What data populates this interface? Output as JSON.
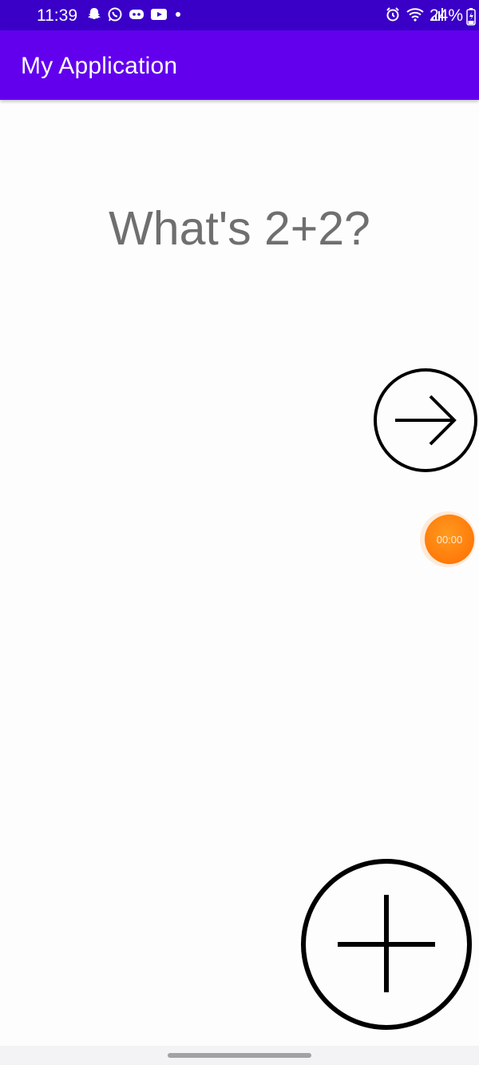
{
  "status_bar": {
    "time": "11:39",
    "left_icons": [
      "snapchat-icon",
      "whatsapp-icon",
      "game-controller-icon",
      "youtube-icon",
      "dot-icon"
    ],
    "right_icons": [
      "alarm-icon",
      "wifi-icon",
      "signal-icon"
    ],
    "battery": "24%",
    "color": "#3a00c8"
  },
  "app_bar": {
    "title": "My Application",
    "color": "#6200ee"
  },
  "main": {
    "question": "What's 2+2?",
    "next_button_icon": "arrow-right-icon",
    "add_button_icon": "plus-icon"
  },
  "timer": {
    "label": "00:00",
    "color": "#ff7a0a"
  },
  "nav_bar": {
    "handle": "home-indicator"
  }
}
